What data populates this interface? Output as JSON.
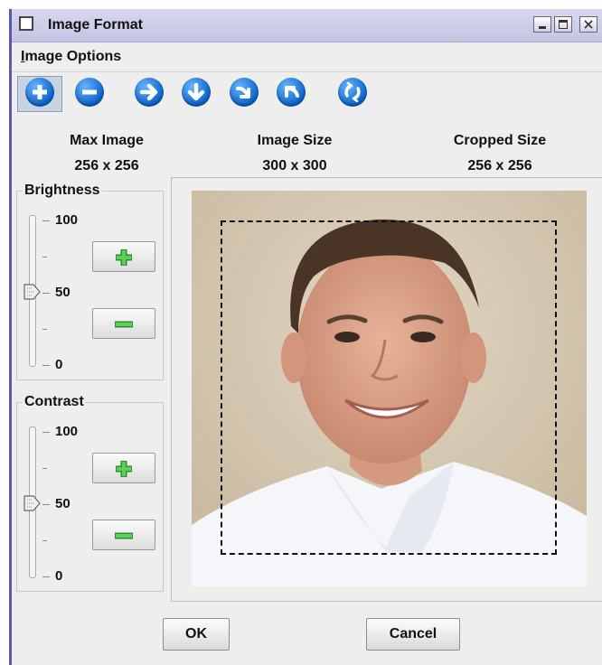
{
  "window": {
    "title": "Image Format"
  },
  "menu": {
    "items": [
      {
        "label": "Image Options",
        "mnemonic": "I"
      }
    ]
  },
  "toolbar": {
    "tools": [
      {
        "icon": "zoom-in-icon",
        "selected": true
      },
      {
        "icon": "zoom-out-icon"
      },
      {
        "icon": "arrow-right-icon"
      },
      {
        "icon": "arrow-down-icon"
      },
      {
        "icon": "rotate-cw-icon"
      },
      {
        "icon": "rotate-ccw-icon"
      },
      {
        "icon": "reset-icon"
      }
    ]
  },
  "headers": {
    "max_label": "Max Image",
    "max_value": "256 x 256",
    "size_label": "Image Size",
    "size_value": "300 x 300",
    "crop_label": "Cropped Size",
    "crop_value": "256 x 256"
  },
  "brightness": {
    "label": "Brightness",
    "ticks": [
      "100",
      "50",
      "0"
    ],
    "value": 50,
    "min": 0,
    "max": 100
  },
  "contrast": {
    "label": "Contrast",
    "ticks": [
      "100",
      "50",
      "0"
    ],
    "value": 50,
    "min": 0,
    "max": 100
  },
  "buttons": {
    "ok": "OK",
    "cancel": "Cancel"
  },
  "colors": {
    "title_bar": "#c8c8e6",
    "window_border": "#5a5aa8",
    "tool_blue": "#0a63c9",
    "plus_minus_green": "#39a83b"
  }
}
